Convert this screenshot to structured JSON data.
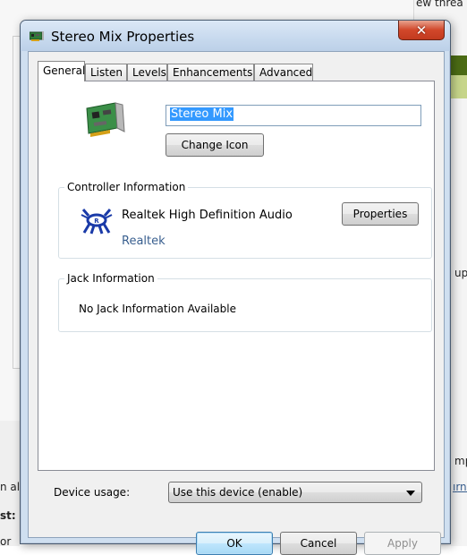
{
  "background": {
    "fragments": [
      "ew threa",
      "up",
      "mp",
      "ırne",
      "n al",
      "st:",
      "or"
    ]
  },
  "window": {
    "title": "Stereo Mix Properties",
    "close_label": "✕"
  },
  "tabs": [
    {
      "label": "General",
      "active": true
    },
    {
      "label": "Listen",
      "active": false
    },
    {
      "label": "Levels",
      "active": false
    },
    {
      "label": "Enhancements",
      "active": false
    },
    {
      "label": "Advanced",
      "active": false
    }
  ],
  "general": {
    "device_name": "Stereo Mix",
    "change_icon_label": "Change Icon",
    "controller": {
      "group_label": "Controller Information",
      "name": "Realtek High Definition Audio",
      "vendor": "Realtek",
      "properties_label": "Properties"
    },
    "jack": {
      "group_label": "Jack Information",
      "status": "No Jack Information Available"
    },
    "device_usage": {
      "label": "Device usage:",
      "selected": "Use this device (enable)"
    }
  },
  "buttons": {
    "ok": "OK",
    "cancel": "Cancel",
    "apply": "Apply"
  },
  "colors": {
    "accent_selection": "#3399ff",
    "link": "#395f8f",
    "close_red": "#c23a1f",
    "frame_blue": "#cfdff0"
  }
}
